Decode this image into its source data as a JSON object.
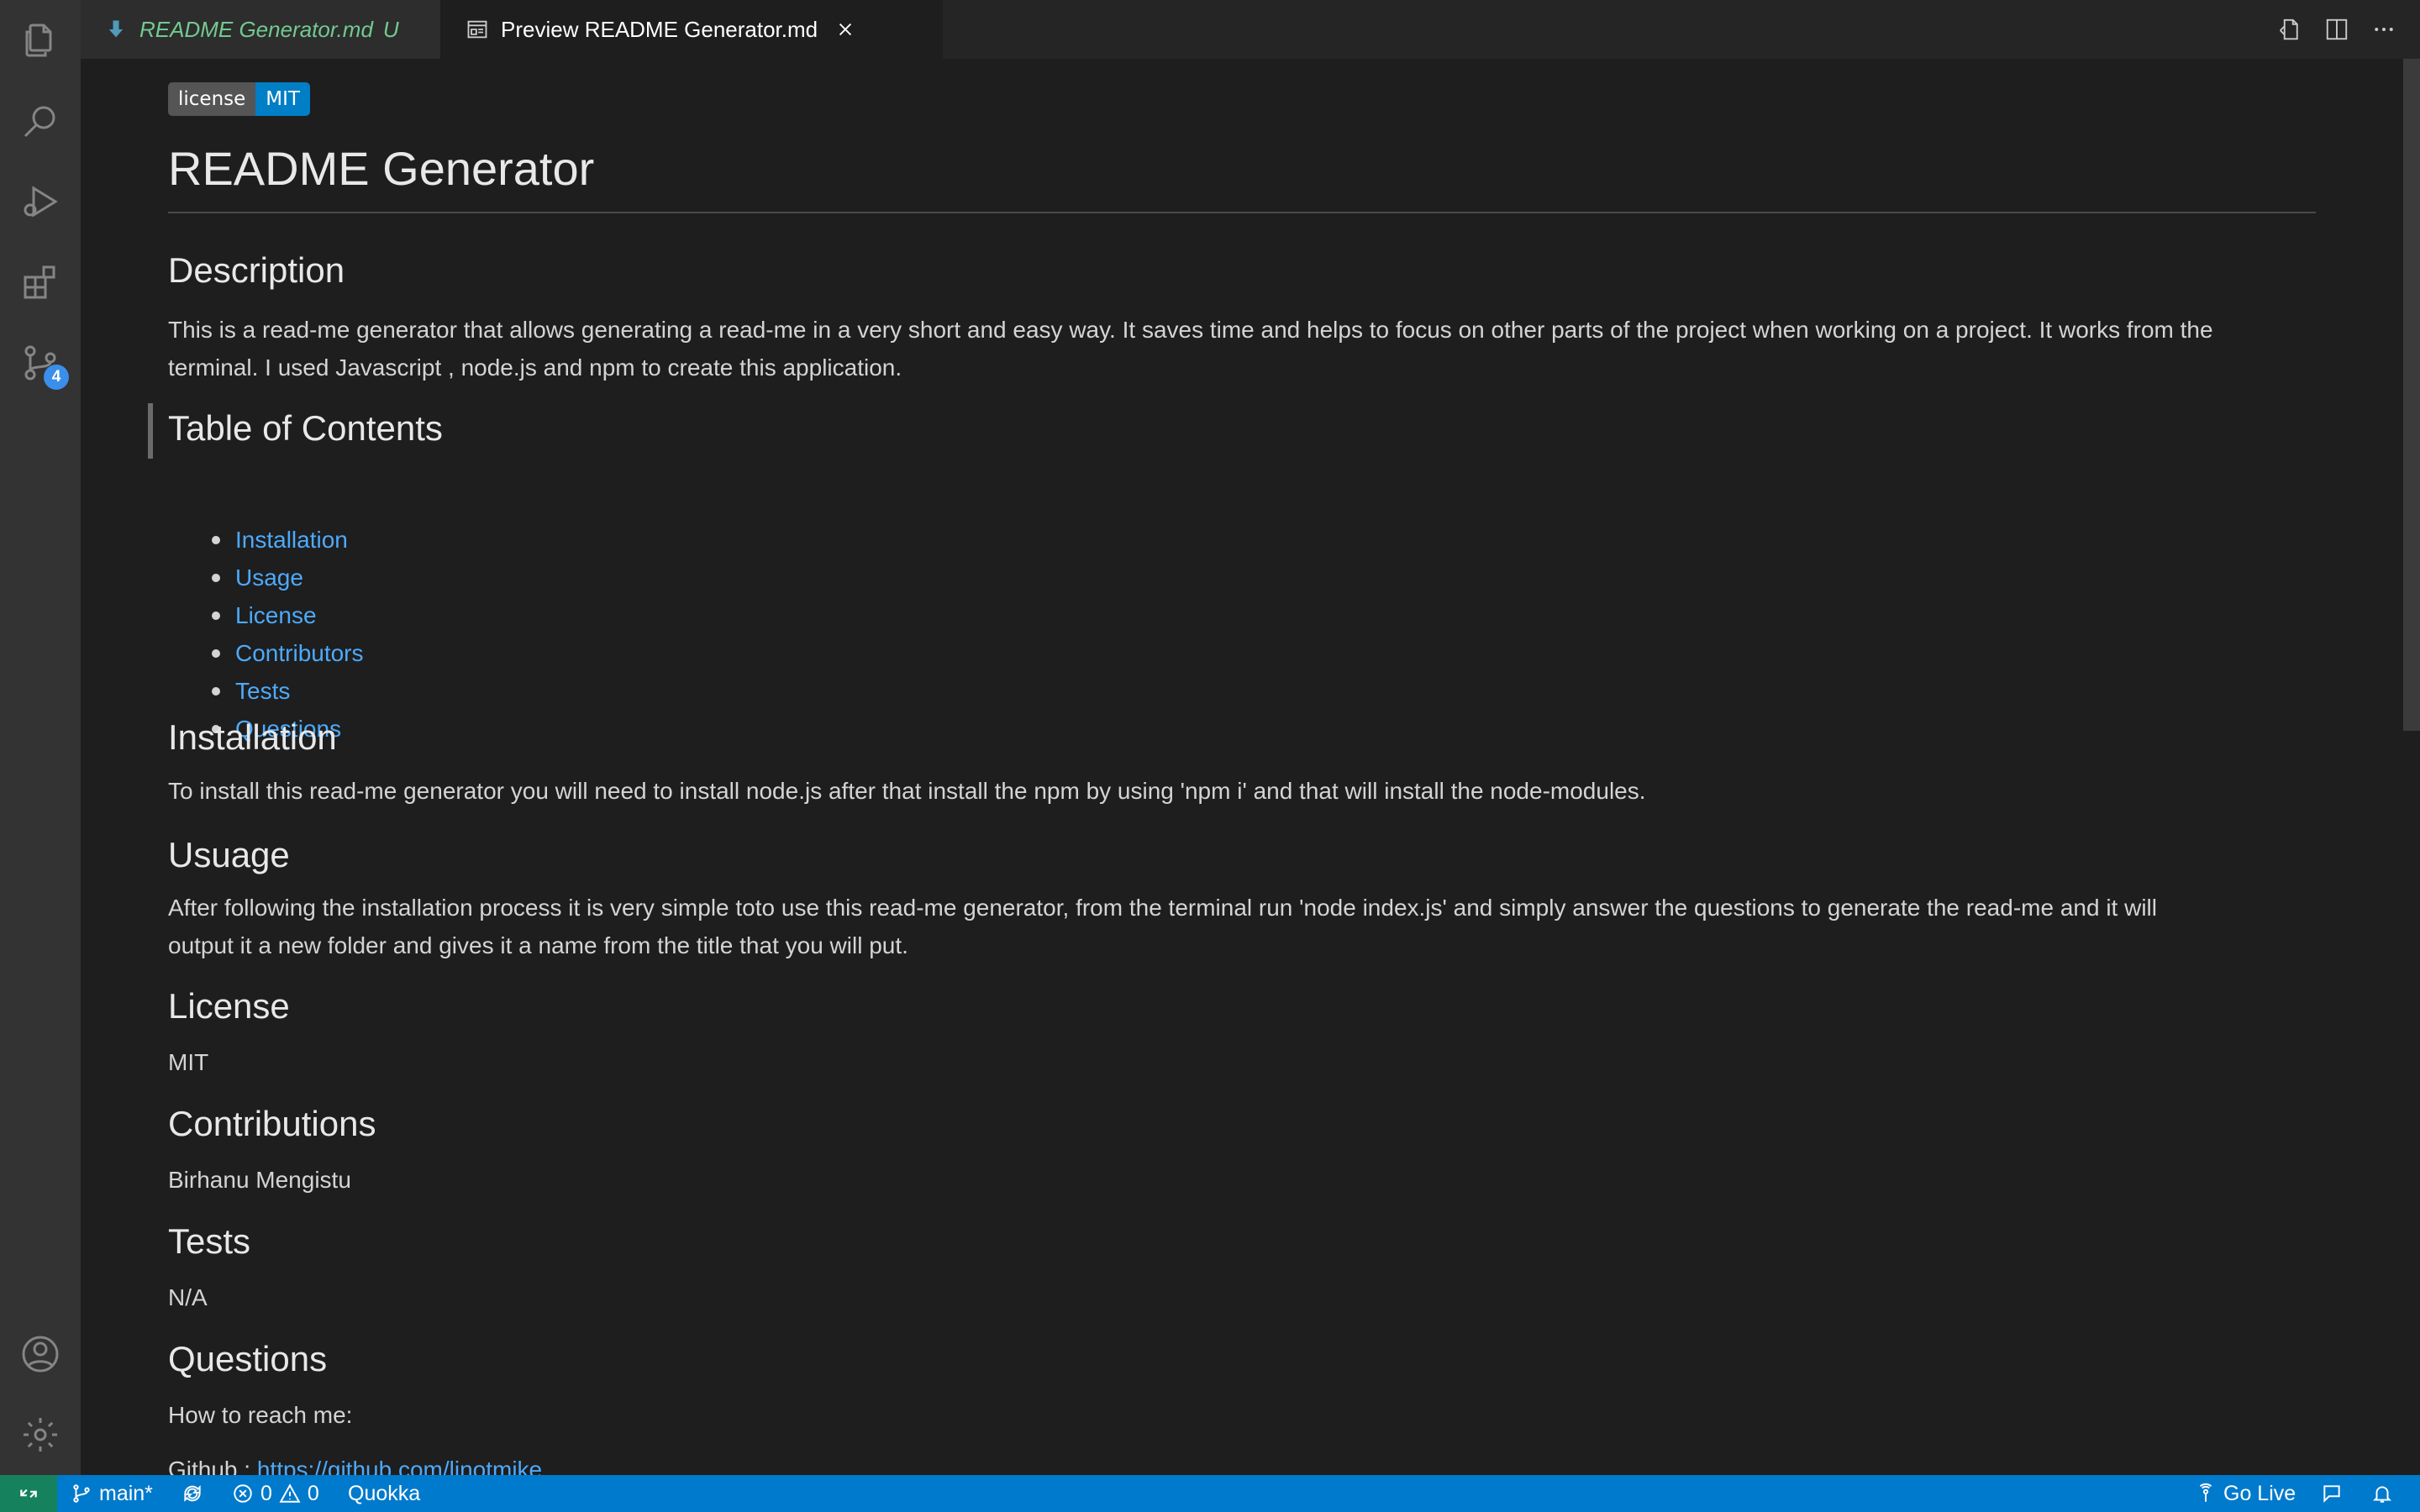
{
  "tabs": [
    {
      "label": "README Generator.md",
      "modified_marker": "U",
      "active": false
    },
    {
      "label": "Preview README Generator.md",
      "active": true
    }
  ],
  "badge": {
    "left": "license",
    "right": "MIT"
  },
  "doc": {
    "title": "README Generator",
    "sections": {
      "description": {
        "heading": "Description",
        "lines": [
          "This is a read-me generator that allows generating a read-me in a very short and easy way. It saves time and helps to focus on other parts of the project when working on a project. It works from the",
          "terminal. I used Javascript , node.js and npm to create this application."
        ]
      },
      "toc": {
        "heading": "Table of Contents",
        "items": [
          "Installation",
          "Usage",
          "License",
          "Contributors",
          "Tests",
          "Questions"
        ]
      },
      "installation": {
        "heading": "Installation",
        "text": "To install this read-me generator you will need to install node.js after that install the npm by using 'npm i' and that will install the node-modules."
      },
      "usage": {
        "heading": "Usuage",
        "lines": [
          "After following the installation process it is very simple toto use this read-me generator, from the terminal run 'node index.js' and simply answer the questions to generate the read-me and it will",
          "output it a new folder and gives it a name from the title that you will put."
        ]
      },
      "license": {
        "heading": "License",
        "text": "MIT"
      },
      "contributions": {
        "heading": "Contributions",
        "text": "Birhanu Mengistu"
      },
      "tests": {
        "heading": "Tests",
        "text": "N/A"
      },
      "questions": {
        "heading": "Questions",
        "text": "How to reach me:",
        "github_label": "Github : ",
        "github_url": "https://github.com/linotmike"
      }
    }
  },
  "activity": {
    "scm_badge": "4"
  },
  "status": {
    "branch": "main*",
    "errors": "0",
    "warnings": "0",
    "quokka": "Quokka",
    "golive": "Go Live"
  },
  "colors": {
    "accent": "#007acc",
    "link": "#4daafc",
    "badge_blue": "#007ec6"
  }
}
